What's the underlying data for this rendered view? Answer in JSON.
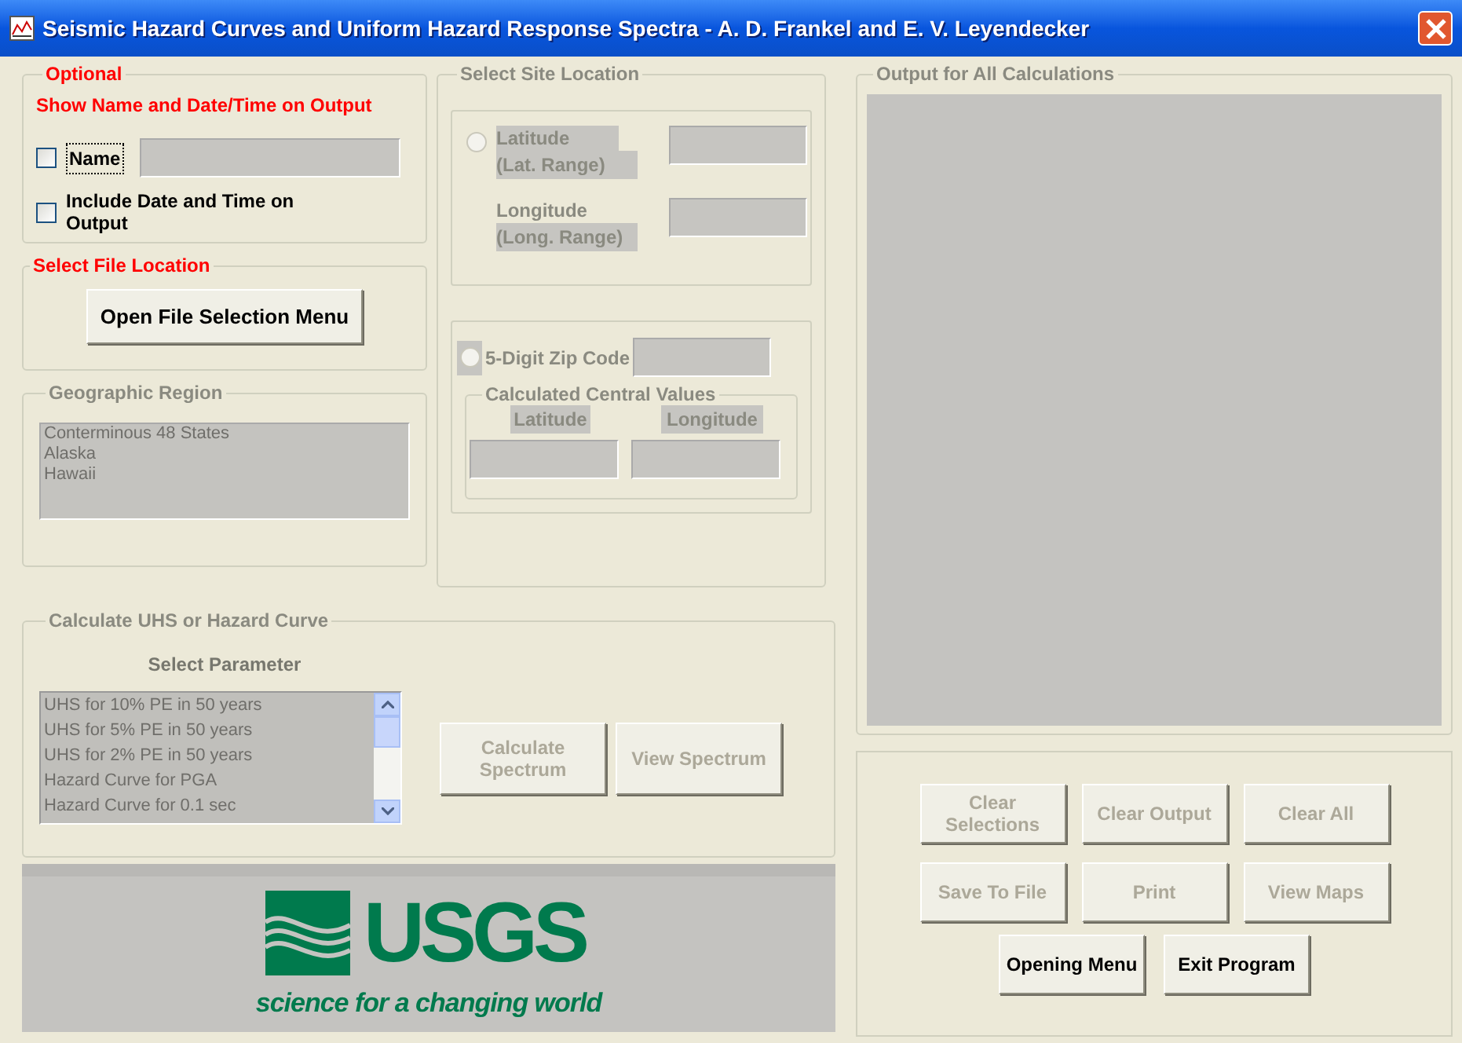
{
  "window": {
    "title": "Seismic Hazard Curves and Uniform Hazard Response Spectra - A. D. Frankel and E. V. Leyendecker"
  },
  "optional": {
    "title": "Optional",
    "subtitle": "Show Name and Date/Time on Output",
    "name_checkbox": {
      "label": "Name",
      "checked": false
    },
    "date_checkbox": {
      "label": "Include Date and Time on Output",
      "checked": false
    }
  },
  "file_location": {
    "title": "Select File Location",
    "button": "Open File Selection Menu"
  },
  "geographic_region": {
    "title": "Geographic Region",
    "items": [
      "Conterminous 48 States",
      "Alaska",
      "Hawaii"
    ]
  },
  "site_location": {
    "title": "Select Site Location",
    "latlon_radio": {
      "selected": false
    },
    "latitude_label": "Latitude",
    "latitude_range": "(Lat. Range)",
    "longitude_label": "Longitude",
    "longitude_range": "(Long. Range)",
    "zip_radio": {
      "label": "5-Digit Zip Code",
      "selected": false
    },
    "central_values": {
      "title": "Calculated Central Values",
      "latitude": "Latitude",
      "longitude": "Longitude"
    }
  },
  "calculate": {
    "title": "Calculate UHS or Hazard Curve",
    "subtitle": "Select Parameter",
    "parameters": [
      "UHS for 10% PE in 50 years",
      "UHS for 5% PE in 50 years",
      "UHS for 2% PE in 50 years",
      "Hazard Curve for PGA",
      "Hazard Curve for 0.1 sec"
    ],
    "buttons": [
      {
        "label": "Calculate Spectrum",
        "disabled": true
      },
      {
        "label": "View Spectrum",
        "disabled": true
      }
    ]
  },
  "logo": {
    "wordmark": "USGS",
    "tagline": "science for a changing world"
  },
  "output": {
    "title": "Output for All Calculations"
  },
  "buttons": [
    {
      "label": "Clear Selections",
      "disabled": true
    },
    {
      "label": "Clear Output",
      "disabled": true
    },
    {
      "label": "Clear All",
      "disabled": true
    },
    {
      "label": "Save To File",
      "disabled": true
    },
    {
      "label": "Print",
      "disabled": true
    },
    {
      "label": "View Maps",
      "disabled": true
    },
    {
      "label": "Opening Menu",
      "disabled": false
    },
    {
      "label": "Exit Program",
      "disabled": false
    }
  ]
}
